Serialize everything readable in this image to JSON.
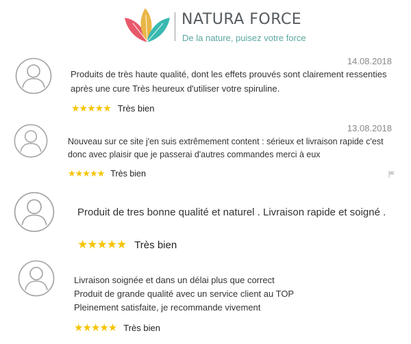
{
  "header": {
    "brand_name": "NATURA FORCE",
    "tagline": "De la nature, puisez votre force"
  },
  "colors": {
    "star": "#f5c400",
    "tagline": "#5aa6a0",
    "avatar_stroke": "#a0a0a0",
    "leaf_red": "#e8586a",
    "leaf_gold": "#e9b646",
    "leaf_teal": "#38b9b0"
  },
  "reviews": [
    {
      "date": "14.08.2018",
      "lines": [
        "Produits de très haute qualité, dont les effets prouvés sont clairement ressenties",
        "après une cure Très heureux d'utiliser votre spiruline."
      ],
      "stars": "★★★★★",
      "rating_value": 5,
      "rating_label": "Très bien"
    },
    {
      "date": "13.08.2018",
      "lines": [
        "Nouveau sur ce site j'en suis extrêmement content : sérieux et livraison rapide c'est",
        "donc avec plaisir que je passerai d'autres commandes merci à eux"
      ],
      "stars": "★★★★★",
      "rating_value": 5,
      "rating_label": "Très bien"
    },
    {
      "lines": [
        "Produit de tres bonne qualité et naturel . Livraison rapide et soigné ."
      ],
      "stars": "★★★★★",
      "rating_value": 5,
      "rating_label": "Très bien"
    },
    {
      "lines": [
        "Livraison soignée et dans un délai plus que correct",
        "Produit de grande qualité avec un service client au TOP",
        "Pleinement satisfaite, je recommande vivement"
      ],
      "stars": "★★★★★",
      "rating_value": 5,
      "rating_label": "Très bien"
    }
  ]
}
